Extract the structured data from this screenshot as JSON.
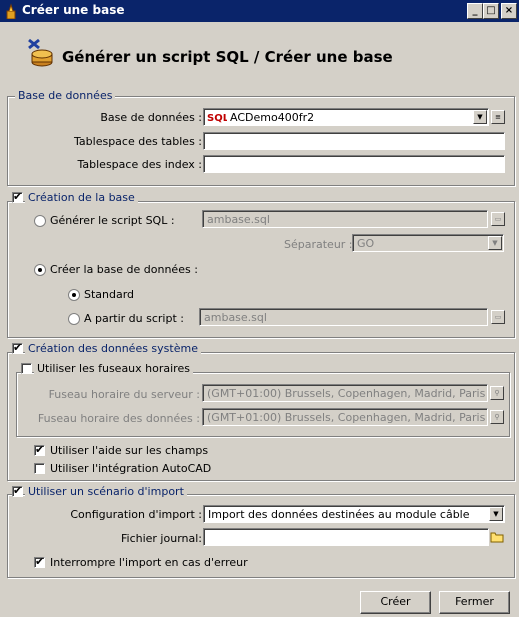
{
  "window": {
    "title": "Créer une base",
    "minimize": "_",
    "maximize": "□",
    "close": "×"
  },
  "header": {
    "title": "Générer un script SQL / Créer une base"
  },
  "database_group": {
    "legend": "Base de données",
    "base_label": "Base de données :",
    "base_value": "ACDemo400fr2",
    "tablespace_tables_label": "Tablespace des tables :",
    "tablespace_tables_value": "",
    "tablespace_index_label": "Tablespace des index :",
    "tablespace_index_value": ""
  },
  "creation_group": {
    "legend": "Création de la base",
    "checked": true,
    "generate_sql_label": "Générer le script SQL :",
    "generate_sql_value": "ambase.sql",
    "separator_label": "Séparateur :",
    "separator_value": "GO",
    "create_db_label": "Créer la base de données :",
    "standard_label": "Standard",
    "from_script_label": "A partir du script :",
    "from_script_value": "ambase.sql"
  },
  "system_data_group": {
    "legend": "Création des données système",
    "checked": true,
    "timezones_legend": "Utiliser les fuseaux horaires",
    "server_tz_label": "Fuseau horaire du serveur :",
    "server_tz_value": "(GMT+01:00) Brussels, Copenhagen, Madrid, Paris",
    "data_tz_label": "Fuseau horaire des données :",
    "data_tz_value": "(GMT+01:00) Brussels, Copenhagen, Madrid, Paris",
    "field_help_label": "Utiliser l'aide sur les champs",
    "field_help_checked": true,
    "autocad_label": "Utiliser l'intégration AutoCAD",
    "autocad_checked": false
  },
  "import_group": {
    "legend": "Utiliser un scénario d'import",
    "checked": true,
    "config_label": "Configuration d'import :",
    "config_value": "Import des données destinées au module câble",
    "journal_label": "Fichier journal:",
    "journal_value": "",
    "interrupt_label": "Interrompre l'import en cas d'erreur",
    "interrupt_checked": true
  },
  "buttons": {
    "create": "Créer",
    "close": "Fermer"
  }
}
